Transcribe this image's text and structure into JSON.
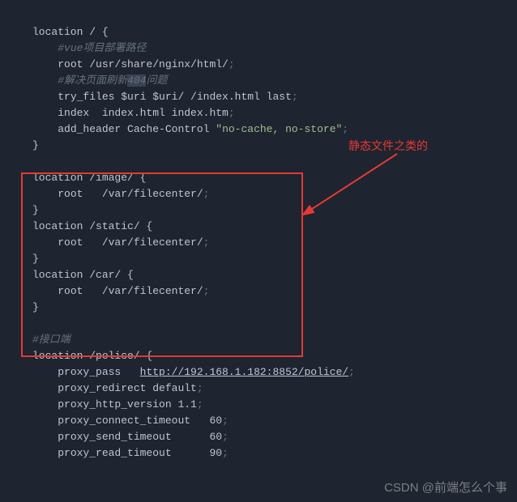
{
  "code": {
    "loc_root": "location / {",
    "comment_vue": "#vue项目部署路径",
    "root_line": "root /usr/share/nginx/html/",
    "comment_404a": "#解决页面刷新",
    "comment_404hl": "404",
    "comment_404b": "问题",
    "try_files": "try_files $uri $uri/ /index.html last",
    "index_line": "index  index.html index.htm",
    "add_header_a": "add_header Cache-Control ",
    "add_header_str": "\"no-cache, no-store\"",
    "close_brace": "}",
    "loc_image": "location /image/ {",
    "root_fc": "root   /var/filecenter/",
    "loc_static": "location /static/ {",
    "loc_car": "location /car/ {",
    "comment_api": "#接口端",
    "loc_police": "location /police/ {",
    "proxy_pass_a": "proxy_pass   ",
    "proxy_pass_url": "http://192.168.1.182:8852/police/",
    "proxy_redirect": "proxy_redirect default",
    "proxy_http": "proxy_http_version 1.1",
    "proxy_connect": "proxy_connect_timeout   60",
    "proxy_send": "proxy_send_timeout      60",
    "proxy_read": "proxy_read_timeout      90",
    "semi": ";"
  },
  "annotation": {
    "text": "静态文件之类的"
  },
  "watermark": {
    "text": "CSDN @前端怎么个事"
  }
}
